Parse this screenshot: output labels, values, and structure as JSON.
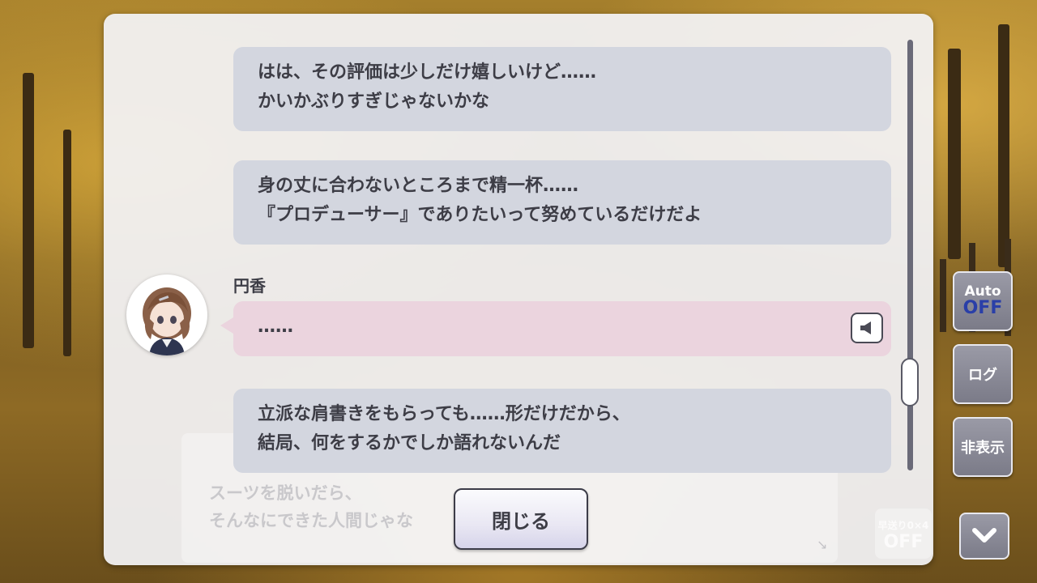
{
  "log": {
    "entries": [
      {
        "lines": [
          "はは、その評価は少しだけ嬉しいけど……",
          "かいかぶりすぎじゃないかな"
        ]
      },
      {
        "lines": [
          "身の丈に合わないところまで精一杯……",
          "『プロデューサー』でありたいって努めているだけだよ"
        ]
      },
      {
        "speaker": "円香",
        "lines": [
          "……"
        ]
      },
      {
        "lines": [
          "立派な肩書きをもらっても……形だけだから、",
          "結局、何をするかでしか語れないんだ"
        ]
      }
    ],
    "close_label": "閉じる"
  },
  "background_text": {
    "line1": "スーツを脱いだら、",
    "line2": "そんなにできた人間じゃな"
  },
  "controls": {
    "auto_label": "Auto",
    "auto_state": "OFF",
    "log_label": "ログ",
    "hide_label": "非表示",
    "skip_label": "早送り0×4",
    "skip_state": "OFF"
  },
  "icons": {
    "voice": "speaker-icon",
    "down": "chevron-down-icon"
  },
  "colors": {
    "bubble_gray": "#d3d6df",
    "bubble_pink": "#ebd4de",
    "auto_off": "#2a3fa8"
  }
}
